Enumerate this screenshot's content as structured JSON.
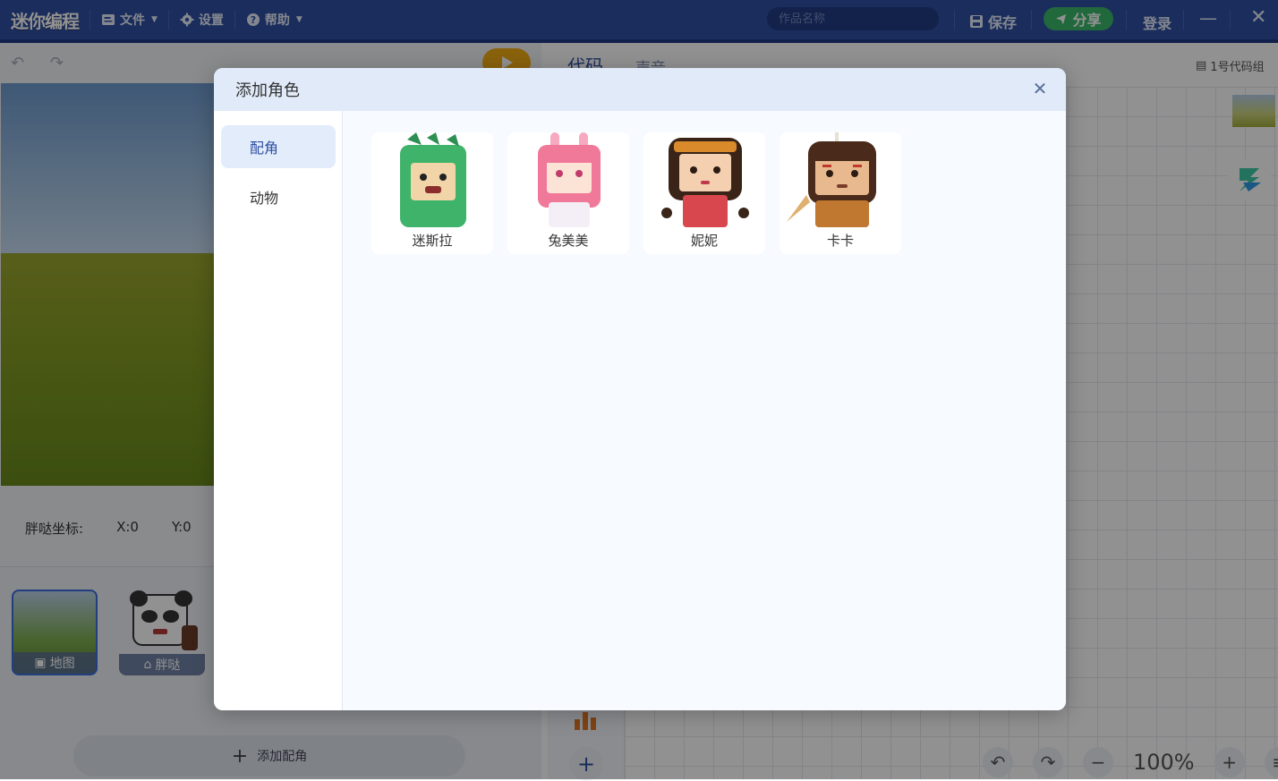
{
  "app": {
    "logo": "迷你编程",
    "menu": {
      "file": "文件",
      "settings": "设置",
      "help": "帮助"
    },
    "project_name_placeholder": "作品名称",
    "save": "保存",
    "share": "分享",
    "login": "登录"
  },
  "stage": {
    "coord_label": "胖哒坐标:",
    "x": "X:0",
    "y": "Y:0"
  },
  "sprites": [
    {
      "label": "地图",
      "icon": "map-icon"
    },
    {
      "label": "胖哒",
      "icon": "character-icon"
    }
  ],
  "add_sprite_label": "添加配角",
  "code_tabs": [
    "代码",
    "声音"
  ],
  "code_group": "1号代码组",
  "zoom": "100%",
  "modal": {
    "title": "添加角色",
    "categories": [
      "配角",
      "动物"
    ],
    "selected_category": "配角",
    "characters": [
      {
        "name": "迷斯拉",
        "color": "#3fb36a"
      },
      {
        "name": "兔美美",
        "color": "#f0799a"
      },
      {
        "name": "妮妮",
        "color": "#d9474e"
      },
      {
        "name": "卡卡",
        "color": "#c0772f"
      }
    ]
  },
  "colors": {
    "topbar": "#2e4fa3",
    "share_green": "#3ab86a",
    "run_orange": "#f3ad16",
    "active_blue": "#e2ecfb"
  }
}
